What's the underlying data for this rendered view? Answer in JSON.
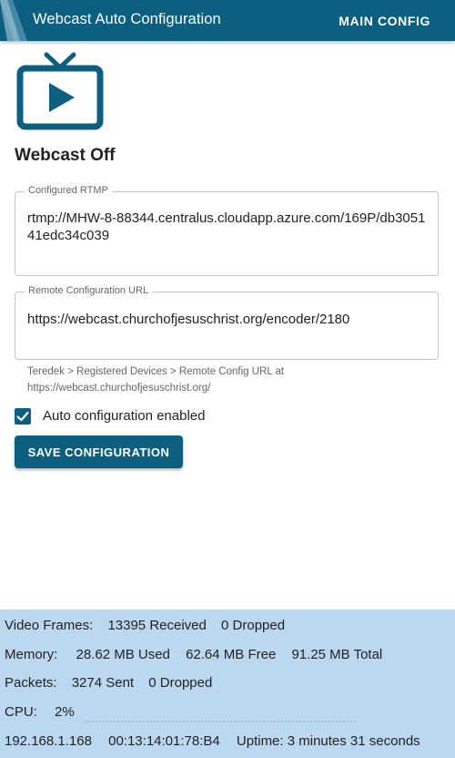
{
  "appbar": {
    "title": "Webcast Auto Configuration",
    "action_label": "MAIN CONFIG"
  },
  "icons": {
    "webcast": "tv-play-icon",
    "checkbox": "check-icon"
  },
  "status": {
    "title": "Webcast Off"
  },
  "rtmp_field": {
    "label": "Configured RTMP",
    "value": "rtmp://MHW-8-88344.centralus.cloudapp.azure.com/169P/db305141edc34c039"
  },
  "remote_field": {
    "label": "Remote Configuration URL",
    "value": "https://webcast.churchofjesuschrist.org/encoder/2180",
    "helper": "Teredek > Registered Devices > Remote Config URL at https://webcast.churchofjesuschrist.org/"
  },
  "auto_config": {
    "label": "Auto configuration enabled",
    "checked": true
  },
  "save_button": {
    "label": "SAVE CONFIGURATION"
  },
  "stats": {
    "video": {
      "label": "Video Frames:",
      "received": "13395 Received",
      "dropped": "0 Dropped"
    },
    "memory": {
      "label": "Memory:",
      "used": "28.62 MB Used",
      "free": "62.64 MB Free",
      "total": "91.25 MB Total"
    },
    "packets": {
      "label": "Packets:",
      "sent": "3274 Sent",
      "dropped": "0 Dropped"
    },
    "cpu": {
      "label": "CPU:",
      "value": "2%"
    },
    "network": {
      "ip": "192.168.1.168",
      "mac": "00:13:14:01:78:B4",
      "uptime": "Uptime: 3 minutes 31 seconds"
    }
  },
  "colors": {
    "primary": "#0d5f80",
    "stats_background": "#bcd8f0"
  }
}
